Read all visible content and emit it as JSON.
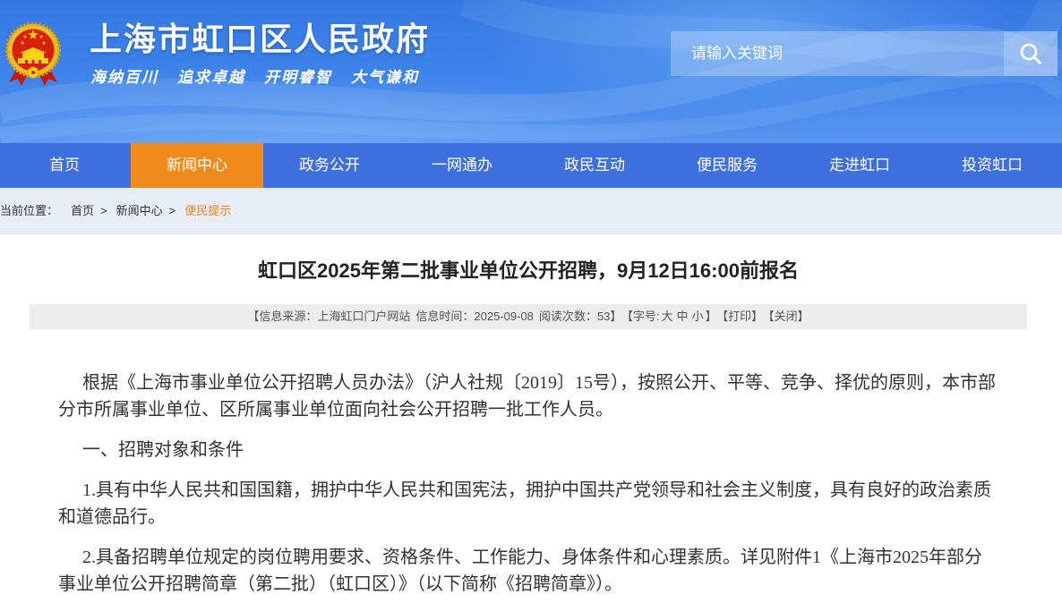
{
  "site": {
    "title": "上海市虹口区人民政府",
    "slogan": [
      "海纳百川",
      "追求卓越",
      "开明睿智",
      "大气谦和"
    ],
    "emblem_icon": "national-emblem-icon"
  },
  "search": {
    "placeholder": "请输入关键词",
    "button_icon": "search-icon"
  },
  "nav": {
    "items": [
      {
        "label": "首页",
        "active": false
      },
      {
        "label": "新闻中心",
        "active": true
      },
      {
        "label": "政务公开",
        "active": false
      },
      {
        "label": "一网通办",
        "active": false
      },
      {
        "label": "政民互动",
        "active": false
      },
      {
        "label": "便民服务",
        "active": false
      },
      {
        "label": "走进虹口",
        "active": false
      },
      {
        "label": "投资虹口",
        "active": false
      }
    ]
  },
  "breadcrumb": {
    "label": "当前位置：",
    "separator": ">",
    "items": [
      "首页",
      "新闻中心",
      "便民提示"
    ]
  },
  "article": {
    "title": "虹口区2025年第二批事业单位公开招聘，9月12日16:00前报名",
    "info": {
      "source_label": "【信息来源：",
      "source": "上海虹口门户网站",
      "time_label": "信息时间：",
      "time": "2025-09-08",
      "views_label": "阅读次数：",
      "views": "53",
      "bracket_close": "】",
      "font_size_label": "【字号:",
      "font_sizes": [
        "大",
        "中",
        "小"
      ],
      "print": "【打印】",
      "close": "【关闭】"
    },
    "paragraphs": [
      "根据《上海市事业单位公开招聘人员办法》（沪人社规〔2019〕15号），按照公开、平等、竞争、择优的原则，本市部分市所属事业单位、区所属事业单位面向社会公开招聘一批工作人员。",
      "一、招聘对象和条件",
      "1.具有中华人民共和国国籍，拥护中华人民共和国宪法，拥护中国共产党领导和社会主义制度，具有良好的政治素质和道德品行。",
      "2.具备招聘单位规定的岗位聘用要求、资格条件、工作能力、身体条件和心理素质。详见附件1《上海市2025年部分事业单位公开招聘简章（第二批）（虹口区）》（以下简称《招聘简章》）。"
    ]
  },
  "colors": {
    "header_blue": "#3478e2",
    "nav_blue": "#3f6fdd",
    "nav_active": "#f08a1a",
    "breadcrumb_bg": "#e8ecf6",
    "breadcrumb_current": "#f0841a",
    "info_bar_bg": "#ececec"
  }
}
